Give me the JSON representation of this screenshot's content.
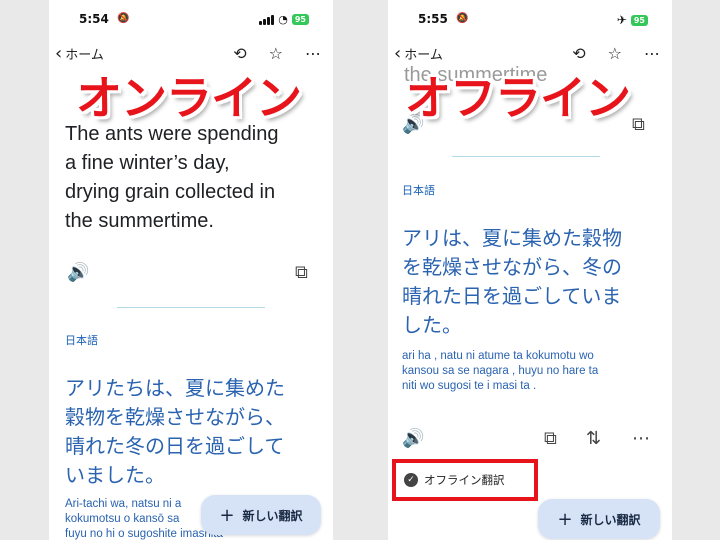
{
  "left": {
    "status": {
      "time": "5:54",
      "battery": "95"
    },
    "nav": {
      "back_label": "ホーム"
    },
    "overlay_title": "オンライン",
    "source_text_lines": [
      "The ants were spending",
      "a fine winter’s day,",
      "drying grain collected in",
      "the summertime."
    ],
    "target_lang": "日本語",
    "target_text_lines": [
      "アリたちは、夏に集めた",
      "穀物を乾燥させながら、",
      "晴れた冬の日を過ごして",
      "いました。"
    ],
    "romaji_lines": [
      "Ari-tachi wa, natsu ni a",
      "kokumotsu o kansō sa",
      "fuyu no hi o sugoshite imashita"
    ],
    "new_translation_label": "新しい翻訳"
  },
  "right": {
    "status": {
      "time": "5:55",
      "battery": "95"
    },
    "nav": {
      "back_label": "ホーム"
    },
    "overlay_title": "オフライン",
    "faded_text": "the summertime",
    "target_lang": "日本語",
    "target_text_lines": [
      "アリは、夏に集めた穀物",
      "を乾燥させながら、冬の",
      "晴れた日を過ごしていま",
      "した。"
    ],
    "romaji_lines": [
      "ari ha , natu ni atume ta kokumotu wo",
      "kansou sa se nagara , huyu no hare ta",
      "niti wo sugosi te i masi ta ."
    ],
    "offline_badge_label": "オフライン翻訳",
    "new_translation_label": "新しい翻訳"
  },
  "icons": [
    "back-chevron-icon",
    "history-icon",
    "star-icon",
    "more-icon",
    "speaker-icon",
    "copy-icon",
    "feedback-icon",
    "check-icon",
    "plus-icon",
    "wifi-icon",
    "airplane-icon",
    "signal-icon",
    "bell-muted-icon"
  ],
  "colors": {
    "highlight": "#e8141c",
    "translation_blue": "#2a63b0",
    "button_bg": "#d6e3f6"
  }
}
